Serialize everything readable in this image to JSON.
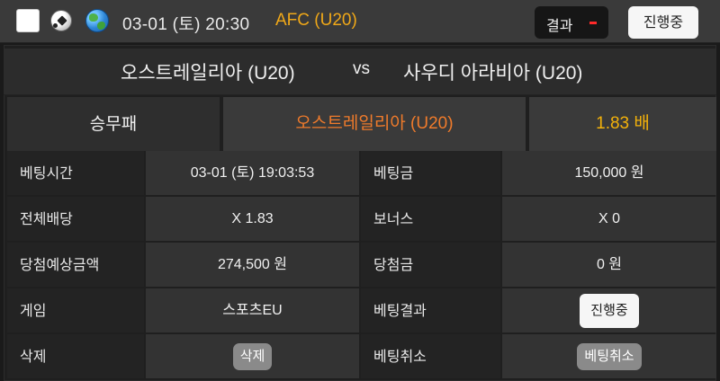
{
  "header": {
    "datetime": "03-01 (토) 20:30",
    "league": "AFC (U20)",
    "result_label": "결과",
    "status_button": "진행중",
    "sport_icon": "soccer-ball-icon",
    "region_icon": "globe-icon"
  },
  "match": {
    "home": "오스트레일리아 (U20)",
    "vs": "vs",
    "away": "사우디 아라비아 (U20)"
  },
  "pick": {
    "type": "승무패",
    "choice": "오스트레일리아 (U20)",
    "odds": "1.83 배"
  },
  "details": {
    "bet_time_label": "베팅시간",
    "bet_time": "03-01 (토) 19:03:53",
    "bet_amount_label": "베팅금",
    "bet_amount": "150,000 원",
    "total_odds_label": "전체배당",
    "total_odds": "X 1.83",
    "bonus_label": "보너스",
    "bonus": "X 0",
    "expected_label": "당첨예상금액",
    "expected": "274,500 원",
    "win_amount_label": "당첨금",
    "win_amount": "0 원",
    "game_label": "게임",
    "game": "스포츠EU",
    "bet_result_label": "베팅결과",
    "bet_result": "진행중",
    "delete_label": "삭제",
    "delete_button": "삭제",
    "cancel_label": "베팅취소",
    "cancel_button": "베팅취소"
  },
  "colors": {
    "league": "#f0a818",
    "choice": "#f07b2b",
    "odds": "#f4b20a",
    "result_indicator": "#ff2a2a"
  }
}
